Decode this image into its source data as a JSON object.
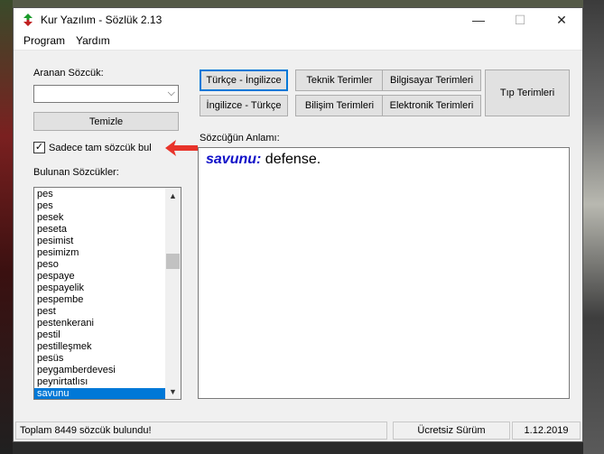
{
  "window": {
    "title": "Kur Yazılım - Sözlük 2.13",
    "controls": {
      "minimize": "—",
      "maximize": "☐",
      "close": "✕"
    }
  },
  "menu": [
    {
      "label": "Program"
    },
    {
      "label": "Yardım"
    }
  ],
  "search": {
    "label": "Aranan Sözcük:",
    "value": "",
    "clear_button": "Temizle",
    "exact_match_label": "Sadece tam sözcük bul",
    "exact_match_checked": true
  },
  "found_words": {
    "label": "Bulunan Sözcükler:",
    "items": [
      "pes",
      "pes",
      "pesek",
      "peseta",
      "pesimist",
      "pesimizm",
      "peso",
      "pespaye",
      "pespayelik",
      "pespembe",
      "pest",
      "pestenkerani",
      "pestil",
      "pestilleşmek",
      "pesüs",
      "peygamberdevesi",
      "peynirtatlısı",
      "savunu"
    ],
    "selected": "savunu"
  },
  "dictionary_buttons": {
    "turkce_ingilizce": "Türkçe - İngilizce",
    "ingilizce_turkce": "İngilizce - Türkçe",
    "teknik": "Teknik Terimler",
    "bilisim": "Bilişim Terimleri",
    "bilgisayar": "Bilgisayar Terimleri",
    "elektronik": "Elektronik Terimleri",
    "tip": "Tıp Terimleri"
  },
  "meaning": {
    "label": "Sözcüğün Anlamı:",
    "word": "savunu:",
    "definition": " defense."
  },
  "status": {
    "message": "Toplam 8449 sözcük bulundu!",
    "edition": "Ücretsiz Sürüm",
    "date": "1.12.2019"
  },
  "colors": {
    "accent": "#0078d7",
    "meaning_word": "#1010c8",
    "annotation_arrow": "#e8332a"
  }
}
